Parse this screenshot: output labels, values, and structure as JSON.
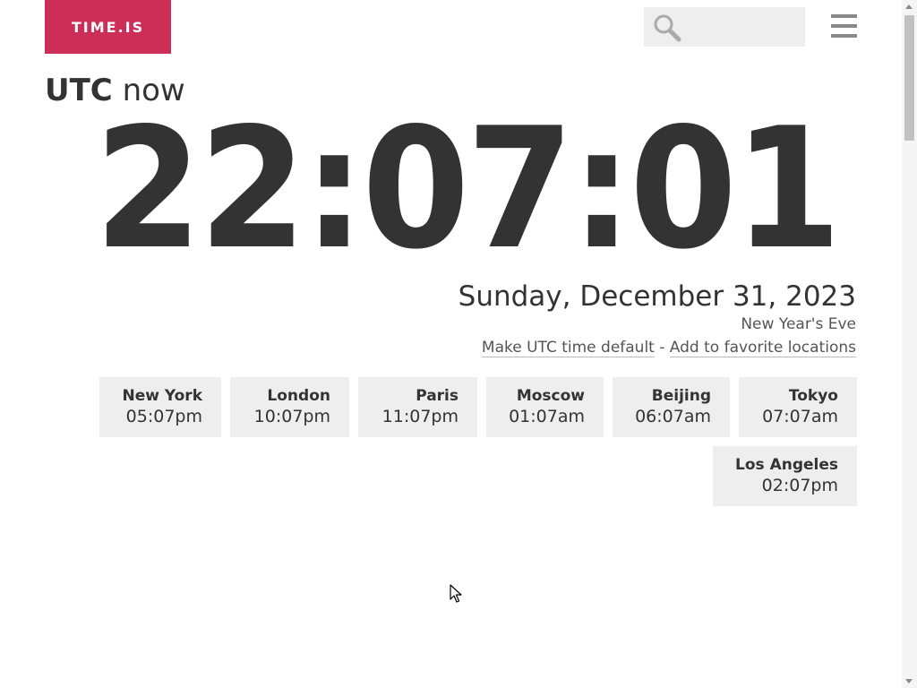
{
  "header": {
    "logo_text": "TIME.IS",
    "brand_color": "#cc2e58",
    "search": {
      "value": "",
      "placeholder": "",
      "icon": "search-icon"
    },
    "menu_icon": "hamburger-menu-icon"
  },
  "main": {
    "zone_label": "UTC",
    "now_label": " now",
    "clock": "22:07:01",
    "date": "Sunday, December 31, 2023",
    "holiday": "New Year's Eve",
    "links": {
      "make_default": "Make UTC time default",
      "separator": " - ",
      "add_favorite": "Add to favorite locations"
    }
  },
  "cities": [
    {
      "name": "New York",
      "time": "05:07pm"
    },
    {
      "name": "London",
      "time": "10:07pm"
    },
    {
      "name": "Paris",
      "time": "11:07pm"
    },
    {
      "name": "Moscow",
      "time": "01:07am"
    },
    {
      "name": "Beijing",
      "time": "06:07am"
    },
    {
      "name": "Tokyo",
      "time": "07:07am"
    },
    {
      "name": "Los Angeles",
      "time": "02:07pm"
    }
  ]
}
